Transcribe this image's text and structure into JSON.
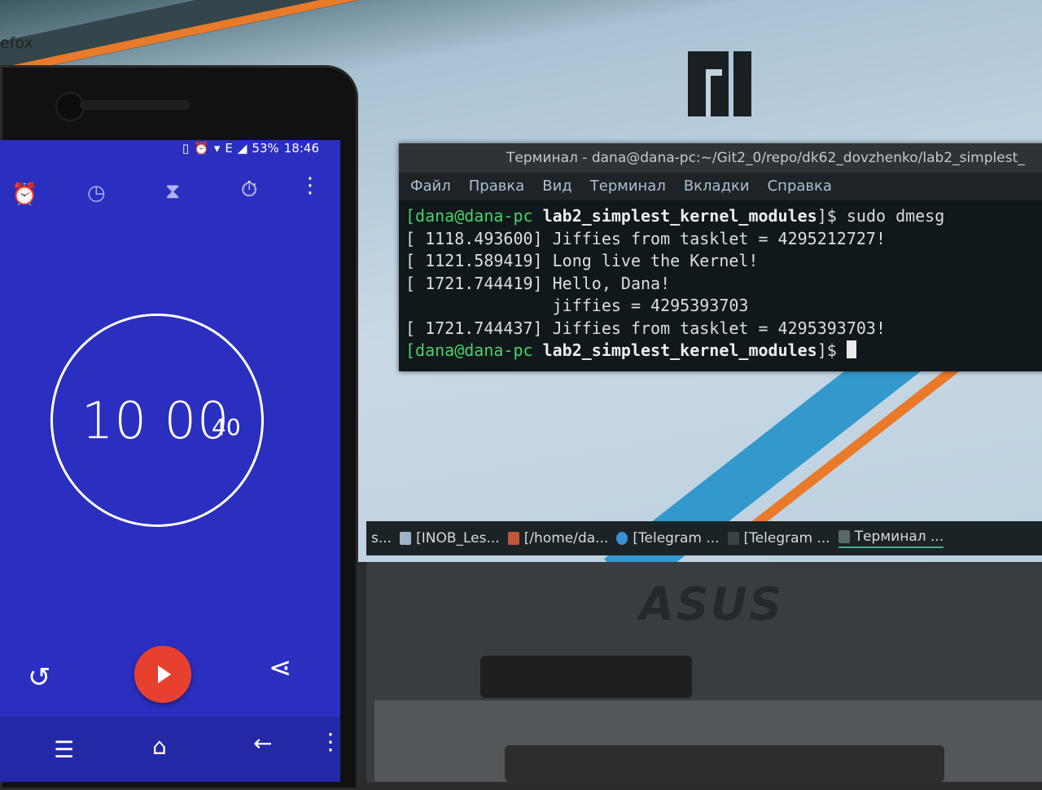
{
  "desktop": {
    "partial_label": "efox"
  },
  "terminal": {
    "title": "Терминал - dana@dana-pc:~/Git2_0/repo/dk62_dovzhenko/lab2_simplest_",
    "menu": [
      "Файл",
      "Правка",
      "Вид",
      "Терминал",
      "Вкладки",
      "Справка"
    ],
    "prompt1_user": "[dana@dana-pc ",
    "prompt1_dir": "lab2_simplest_kernel_modules",
    "prompt1_tail": "]$ sudo dmesg",
    "log_lines": [
      "[ 1118.493600] Jiffies from tasklet = 4295212727!",
      "[ 1121.589419] Long live the Kernel!",
      "[ 1721.744419] Hello, Dana!",
      "               jiffies = 4295393703",
      "[ 1721.744437] Jiffies from tasklet = 4295393703!"
    ],
    "prompt2_user": "[dana@dana-pc ",
    "prompt2_dir": "lab2_simplest_kernel_modules",
    "prompt2_tail": "]$ "
  },
  "taskbar": {
    "items": [
      "s...",
      "[INOB_Les...",
      "[/home/da...",
      "[Telegram ...",
      "[Telegram ...",
      "Терминал ..."
    ]
  },
  "laptop": {
    "brand": "ASUS"
  },
  "phone": {
    "status": {
      "battery": "53%",
      "time": "18:46",
      "network": "E"
    },
    "timer": {
      "main": "10 00",
      "sub": "40"
    },
    "icons": {
      "alarm": "alarm-icon",
      "clock": "clock-icon",
      "timer": "hourglass-icon",
      "stopwatch": "stopwatch-icon",
      "reset": "reset-icon",
      "play": "play-icon",
      "share": "share-icon"
    }
  },
  "colors": {
    "phone_bg": "#2a2fbf",
    "play_button": "#e8402f",
    "prompt_green": "#4cd16a",
    "terminal_bg": "#10181b"
  }
}
